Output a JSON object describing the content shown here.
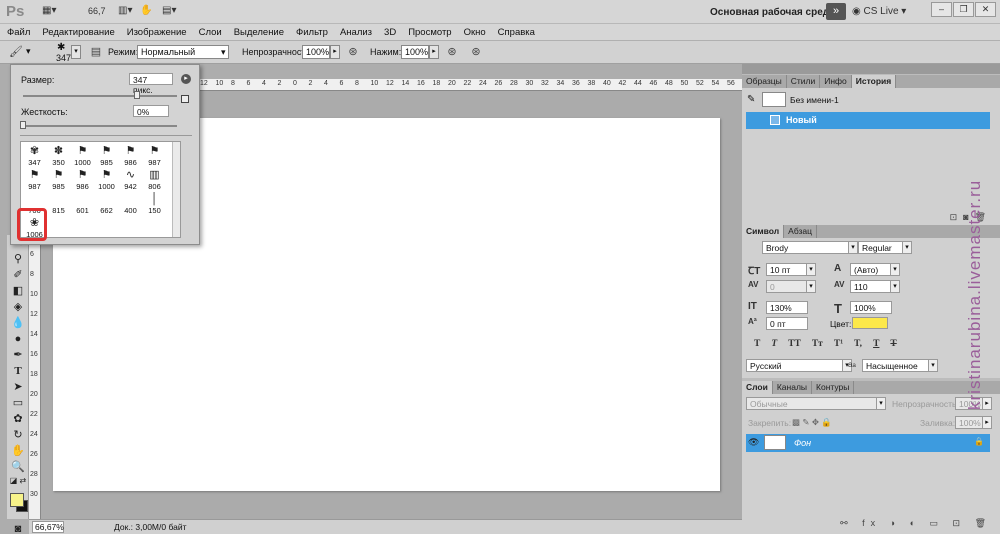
{
  "app": {
    "logo": "Ps",
    "zoom": "66,7",
    "workspace": "Основная рабочая среда",
    "workspace_btn": "»",
    "cs_live": "CS Live"
  },
  "menu": [
    "Файл",
    "Редактирование",
    "Изображение",
    "Слои",
    "Выделение",
    "Фильтр",
    "Анализ",
    "3D",
    "Просмотр",
    "Окно",
    "Справка"
  ],
  "options": {
    "brush_size": "347",
    "mode_label": "Режим:",
    "mode_value": "Нормальный",
    "opacity_label": "Непрозрачность:",
    "opacity_value": "100%",
    "pressure_label": "Нажим:",
    "pressure_value": "100%"
  },
  "brush_panel": {
    "size_label": "Размер:",
    "size_value": "347 пикс.",
    "hardness_label": "Жесткость:",
    "hardness_value": "0%",
    "size_slider_fraction": 0.74,
    "hardness_slider_fraction": 0.0,
    "brushes": [
      "347",
      "350",
      "1000",
      "985",
      "986",
      "987",
      "987",
      "985",
      "986",
      "1000",
      "942",
      "806",
      "700",
      "815",
      "601",
      "662",
      "400",
      "150",
      "1006"
    ]
  },
  "rulers": {
    "top": [
      "12",
      "10",
      "8",
      "6",
      "4",
      "2",
      "0",
      "2",
      "4",
      "6",
      "8",
      "10",
      "12",
      "14",
      "16",
      "18",
      "20",
      "22",
      "24",
      "26",
      "28",
      "30",
      "32",
      "34",
      "36",
      "38",
      "40",
      "42",
      "44",
      "46",
      "48",
      "50",
      "52",
      "54",
      "56"
    ],
    "left": [
      "6",
      "8",
      "10",
      "12",
      "14",
      "16",
      "18",
      "20",
      "22",
      "24",
      "26",
      "28",
      "30"
    ]
  },
  "status": {
    "zoom": "66,67%",
    "doc": "Док.: 3,00M/0 байт"
  },
  "history": {
    "tabs": [
      "Образцы",
      "Стили",
      "Инфо",
      "История"
    ],
    "active_tab": "История",
    "snapshot": "Без имени-1",
    "items": [
      "Новый"
    ]
  },
  "character": {
    "tabs": [
      "Символ",
      "Абзац"
    ],
    "font": "Brody",
    "style": "Regular",
    "size": "10 пт",
    "leading": "(Авто)",
    "kerning": "0",
    "tracking": "110",
    "vscale": "130%",
    "hscale": "100%",
    "baseline": "0 пт",
    "color_label": "Цвет:",
    "color": "#fce84a",
    "styles": [
      "T",
      "T",
      "TT",
      "Tт",
      "T¹",
      "T,",
      "T",
      "T"
    ],
    "language": "Русский",
    "aa_label": "a",
    "aa_prefix": "a",
    "antialias": "Насыщенное"
  },
  "layers": {
    "tabs": [
      "Слои",
      "Каналы",
      "Контуры"
    ],
    "blend": "Обычные",
    "opacity_label": "Непрозрачность:",
    "opacity": "100%",
    "lock_label": "Закрепить:",
    "fill_label": "Заливка:",
    "fill": "100%",
    "items": [
      {
        "name": "Фон",
        "locked": true
      }
    ]
  },
  "watermark": "kristinarubina.livemaster.ru",
  "colors": {
    "accent": "#3d9bdf",
    "highlight": "#e03131",
    "foreground": "#f7f38a",
    "background": "#111111"
  }
}
